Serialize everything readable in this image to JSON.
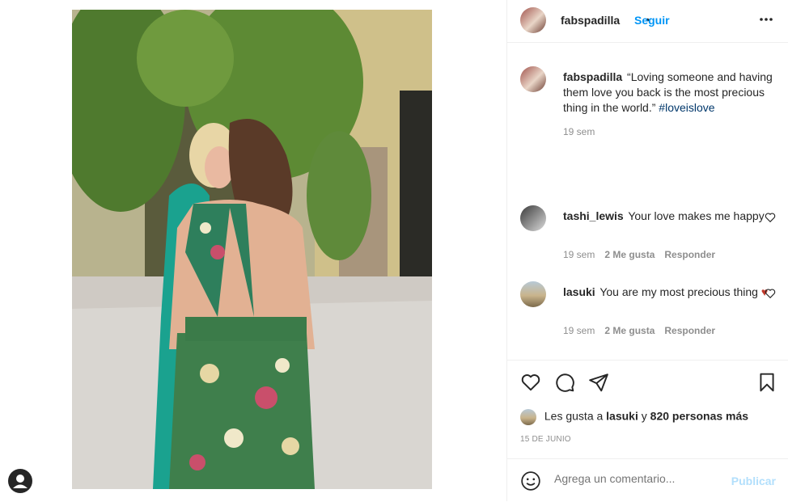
{
  "post": {
    "username": "fabspadilla",
    "follow_label": "Seguir",
    "separator": "•",
    "more_label": "•••"
  },
  "caption": {
    "username": "fabspadilla",
    "text": "“Loving someone and having them love you back is the most precious thing in the world.”",
    "hashtag": "#loveislove",
    "time": "19 sem"
  },
  "comments": [
    {
      "username": "tashi_lewis",
      "text": "Your love makes me happy",
      "time": "19 sem",
      "likes": "2 Me gusta",
      "reply": "Responder"
    },
    {
      "username": "lasuki",
      "text": "You are my most precious thing",
      "emoji": "♥",
      "time": "19 sem",
      "likes": "2 Me gusta",
      "reply": "Responder"
    }
  ],
  "likes": {
    "prefix": "Les gusta a",
    "user": "lasuki",
    "and": "y",
    "others": "820 personas más"
  },
  "date": "15 DE JUNIO",
  "add_comment": {
    "placeholder": "Agrega un comentario...",
    "publish": "Publicar"
  },
  "colors": {
    "link": "#0095f6",
    "hashtag": "#00376b",
    "heart": "#c0392b",
    "muted": "#8e8e8e"
  },
  "icons": [
    "profile-icon",
    "heart-icon",
    "comment-icon",
    "share-icon",
    "bookmark-icon",
    "emoji-icon",
    "more-icon"
  ]
}
